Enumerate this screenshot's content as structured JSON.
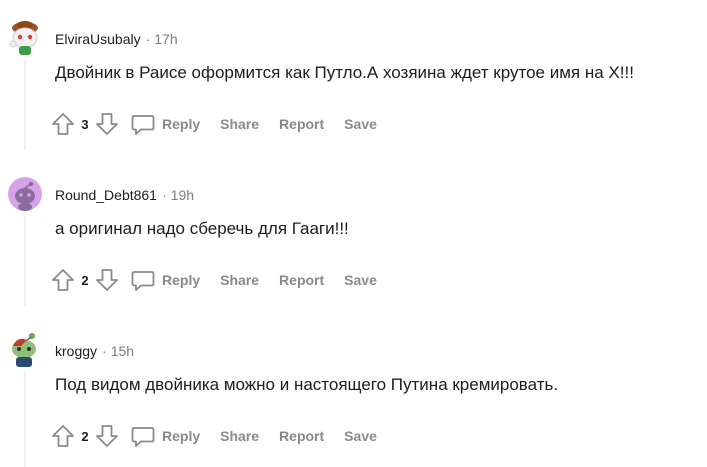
{
  "comments": [
    {
      "username": "ElviraUsubaly",
      "time": "17h",
      "text": "Двойник в Раисе оформится как Путло.А хозяина ждет крутое имя на Х!!!",
      "score": "3",
      "avatar_icon": "snoo-avatar-hat-icon"
    },
    {
      "username": "Round_Debt861",
      "time": "19h",
      "text": "а оригинал надо сберечь для Гааги!!!",
      "score": "2",
      "avatar_icon": "snoo-avatar-purple-icon"
    },
    {
      "username": "kroggy",
      "time": "15h",
      "text": "Под видом двойника можно и настоящего Путина кремировать.",
      "score": "2",
      "avatar_icon": "snoo-avatar-zombie-icon"
    }
  ],
  "actions": {
    "separator": "·",
    "reply": "Reply",
    "share": "Share",
    "report": "Report",
    "save": "Save"
  },
  "colors": {
    "meta_gray": "#7c7c7c",
    "action_gray": "#878a8c",
    "thread_line": "#edeff1"
  }
}
